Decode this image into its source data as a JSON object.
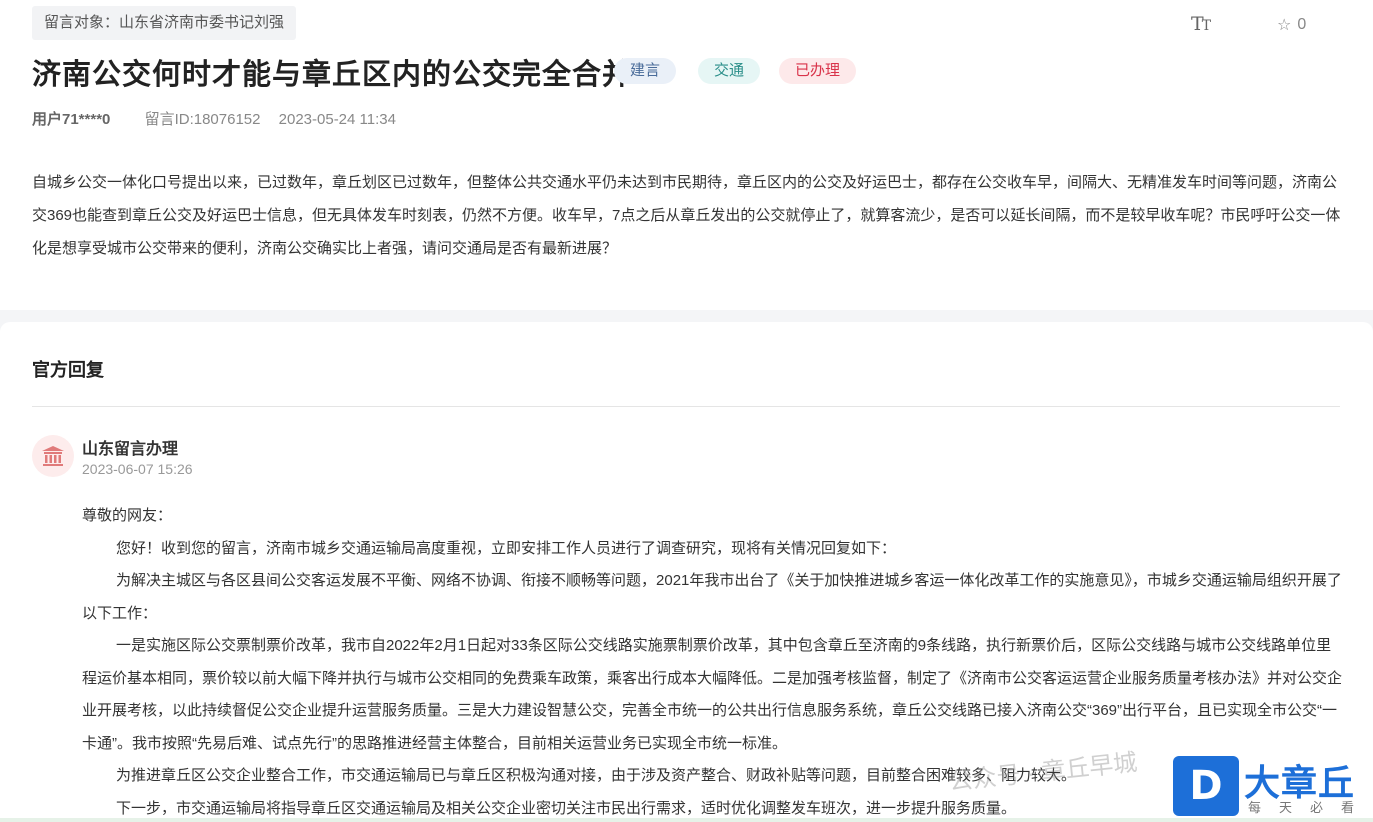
{
  "header": {
    "target_label": "留言对象：山东省济南市委书记刘强",
    "font_tool_icon": "text-size-icon",
    "favorite_count": "0"
  },
  "title": "济南公交何时才能与章丘区内的公交完全合并",
  "tags": [
    "建言",
    "交通",
    "已办理"
  ],
  "meta": {
    "user": "用户71****0",
    "message_id": "留言ID:18076152",
    "time": "2023-05-24 11:34"
  },
  "content": "自城乡公交一体化口号提出以来，已过数年，章丘划区已过数年，但整体公共交通水平仍未达到市民期待，章丘区内的公交及好运巴士，都存在公交收车早，间隔大、无精准发车时间等问题，济南公交369也能查到章丘公交及好运巴士信息，但无具体发车时刻表，仍然不方便。收车早，7点之后从章丘发出的公交就停止了，就算客流少，是否可以延长间隔，而不是较早收车呢？市民呼吁公交一体化是想享受城市公交带来的便利，济南公交确实比上者强，请问交通局是否有最新进展？",
  "reply_section": {
    "title": "官方回复",
    "org_name": "山东留言办理",
    "org_time": "2023-06-07 15:26",
    "paragraphs": [
      "尊敬的网友：",
      "您好！收到您的留言，济南市城乡交通运输局高度重视，立即安排工作人员进行了调查研究，现将有关情况回复如下：",
      "为解决主城区与各区县间公交客运发展不平衡、网络不协调、衔接不顺畅等问题，2021年我市出台了《关于加快推进城乡客运一体化改革工作的实施意见》，市城乡交通运输局组织开展了以下工作：",
      "一是实施区际公交票制票价改革，我市自2022年2月1日起对33条区际公交线路实施票制票价改革，其中包含章丘至济南的9条线路，执行新票价后，区际公交线路与城市公交线路单位里程运价基本相同，票价较以前大幅下降并执行与城市公交相同的免费乘车政策，乘客出行成本大幅降低。二是加强考核监督，制定了《济南市公交客运运营企业服务质量考核办法》并对公交企业开展考核，以此持续督促公交企业提升运营服务质量。三是大力建设智慧公交，完善全市统一的公共出行信息服务系统，章丘公交线路已接入济南公交“369”出行平台，且已实现全市公交“一卡通”。我市按照“先易后难、试点先行”的思路推进经营主体整合，目前相关运营业务已实现全市统一标准。",
      "为推进章丘区公交企业整合工作，市交通运输局已与章丘区积极沟通对接，由于涉及资产整合、财政补贴等问题，目前整合困难较多、阻力较大。",
      "下一步，市交通运输局将指导章丘区交通运输局及相关公交企业密切关注市民出行需求，适时优化调整发车班次，进一步提升服务质量。"
    ]
  },
  "watermark": {
    "text": "公众号 · 章丘早城",
    "logo_letter": "D",
    "logo_name": "大章丘",
    "logo_slogan": "每天必看"
  },
  "colors": {
    "tag_suggest": "#4a6c9a",
    "tag_traffic": "#2b8f8a",
    "tag_done": "#d9334a",
    "logo_blue": "#1d6fd8"
  }
}
